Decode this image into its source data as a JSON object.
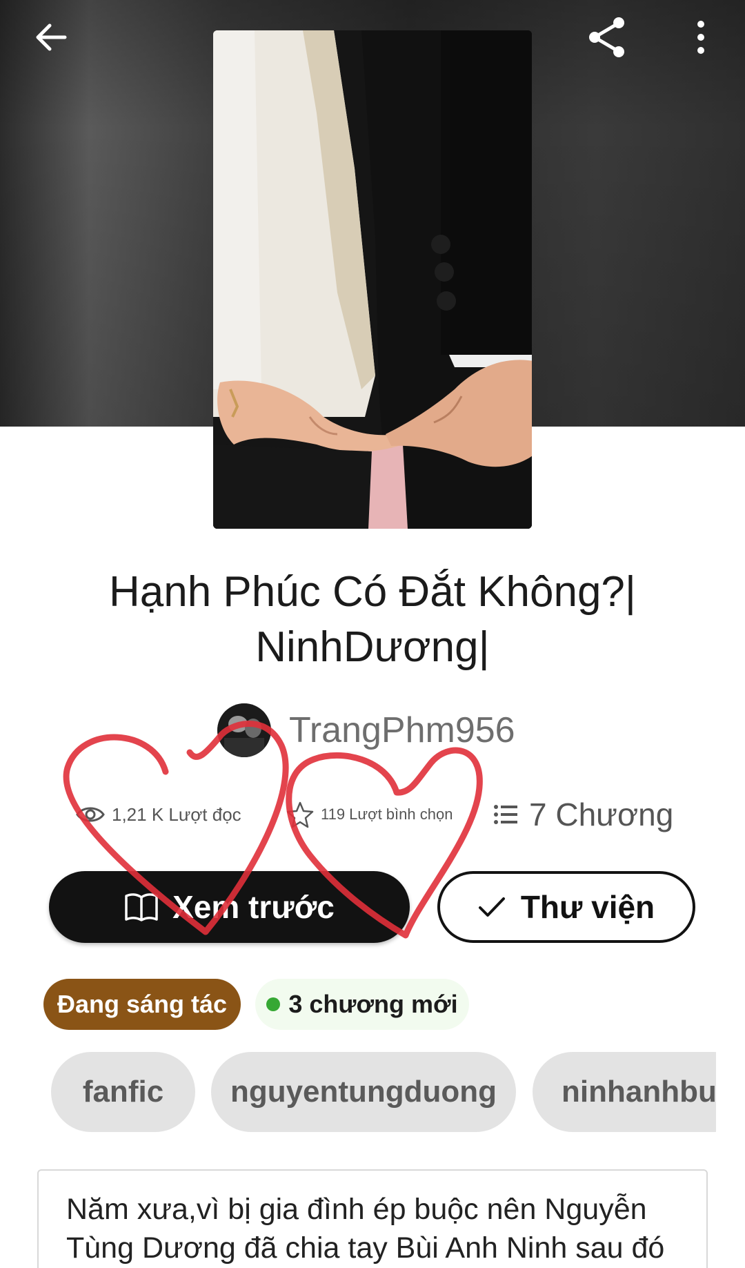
{
  "header": {
    "back_icon": "arrow-left-icon",
    "share_icon": "share-icon",
    "more_icon": "more-vertical-icon"
  },
  "story": {
    "title_line1": "Hạnh Phúc Có Đắt Không?|",
    "title_line2": "NinhDương|",
    "author": "TrangPhm956"
  },
  "stats": {
    "reads": "1,21 K Lượt đọc",
    "votes": "119 Lượt bình chọn",
    "parts": "7 Chương"
  },
  "actions": {
    "preview_label": "Xem trước",
    "library_label": "Thư viện"
  },
  "badges": {
    "status": "Đang sáng tác",
    "new_chapters": "3 chương mới"
  },
  "tags": [
    "fanfic",
    "nguyentungduong",
    "ninhanhbui"
  ],
  "description": "Năm xưa,vì bị gia đình ép buộc nên Nguyễn Tùng Dương đã chia tay Bùi Anh Ninh sau đó",
  "colors": {
    "status_badge": "#8a5416",
    "new_dot": "#36a834",
    "dark_button": "#121212",
    "scribble": "#e0303a"
  }
}
